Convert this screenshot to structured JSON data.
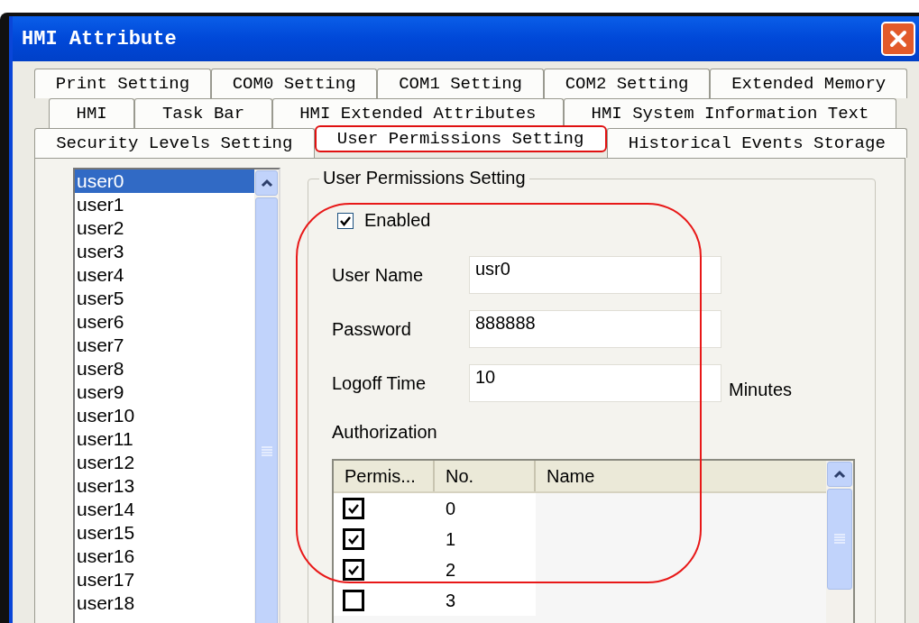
{
  "window": {
    "title": "HMI Attribute"
  },
  "tab_rows": [
    [
      {
        "label": "Print Setting",
        "selected": false
      },
      {
        "label": "COM0 Setting",
        "selected": false
      },
      {
        "label": "COM1 Setting",
        "selected": false
      },
      {
        "label": "COM2 Setting",
        "selected": false
      },
      {
        "label": "Extended Memory",
        "selected": false
      }
    ],
    [
      {
        "label": "HMI",
        "selected": false
      },
      {
        "label": "Task Bar",
        "selected": false
      },
      {
        "label": "HMI Extended Attributes",
        "selected": false
      },
      {
        "label": "HMI System Information Text",
        "selected": false
      }
    ],
    [
      {
        "label": "Security Levels Setting",
        "selected": false
      },
      {
        "label": "User Permissions Setting",
        "selected": true
      },
      {
        "label": "Historical Events Storage",
        "selected": false
      }
    ]
  ],
  "user_list": [
    {
      "label": "user0",
      "selected": true
    },
    {
      "label": "user1",
      "selected": false
    },
    {
      "label": "user2",
      "selected": false
    },
    {
      "label": "user3",
      "selected": false
    },
    {
      "label": "user4",
      "selected": false
    },
    {
      "label": "user5",
      "selected": false
    },
    {
      "label": "user6",
      "selected": false
    },
    {
      "label": "user7",
      "selected": false
    },
    {
      "label": "user8",
      "selected": false
    },
    {
      "label": "user9",
      "selected": false
    },
    {
      "label": "user10",
      "selected": false
    },
    {
      "label": "user11",
      "selected": false
    },
    {
      "label": "user12",
      "selected": false
    },
    {
      "label": "user13",
      "selected": false
    },
    {
      "label": "user14",
      "selected": false
    },
    {
      "label": "user15",
      "selected": false
    },
    {
      "label": "user16",
      "selected": false
    },
    {
      "label": "user17",
      "selected": false
    },
    {
      "label": "user18",
      "selected": false
    }
  ],
  "group": {
    "title": "User Permissions Setting",
    "enabled": {
      "label": "Enabled",
      "checked": true
    },
    "fields": [
      {
        "label": "User Name",
        "value": "usr0"
      },
      {
        "label": "Password",
        "value": "888888"
      },
      {
        "label": "Logoff Time",
        "value": "10",
        "unit": "Minutes"
      }
    ],
    "authorization": {
      "label": "Authorization",
      "columns": [
        "Permis...",
        "No.",
        "Name"
      ],
      "rows": [
        {
          "checked": true,
          "no": "0"
        },
        {
          "checked": true,
          "no": "1"
        },
        {
          "checked": true,
          "no": "2"
        },
        {
          "checked": false,
          "no": "3"
        }
      ]
    }
  }
}
